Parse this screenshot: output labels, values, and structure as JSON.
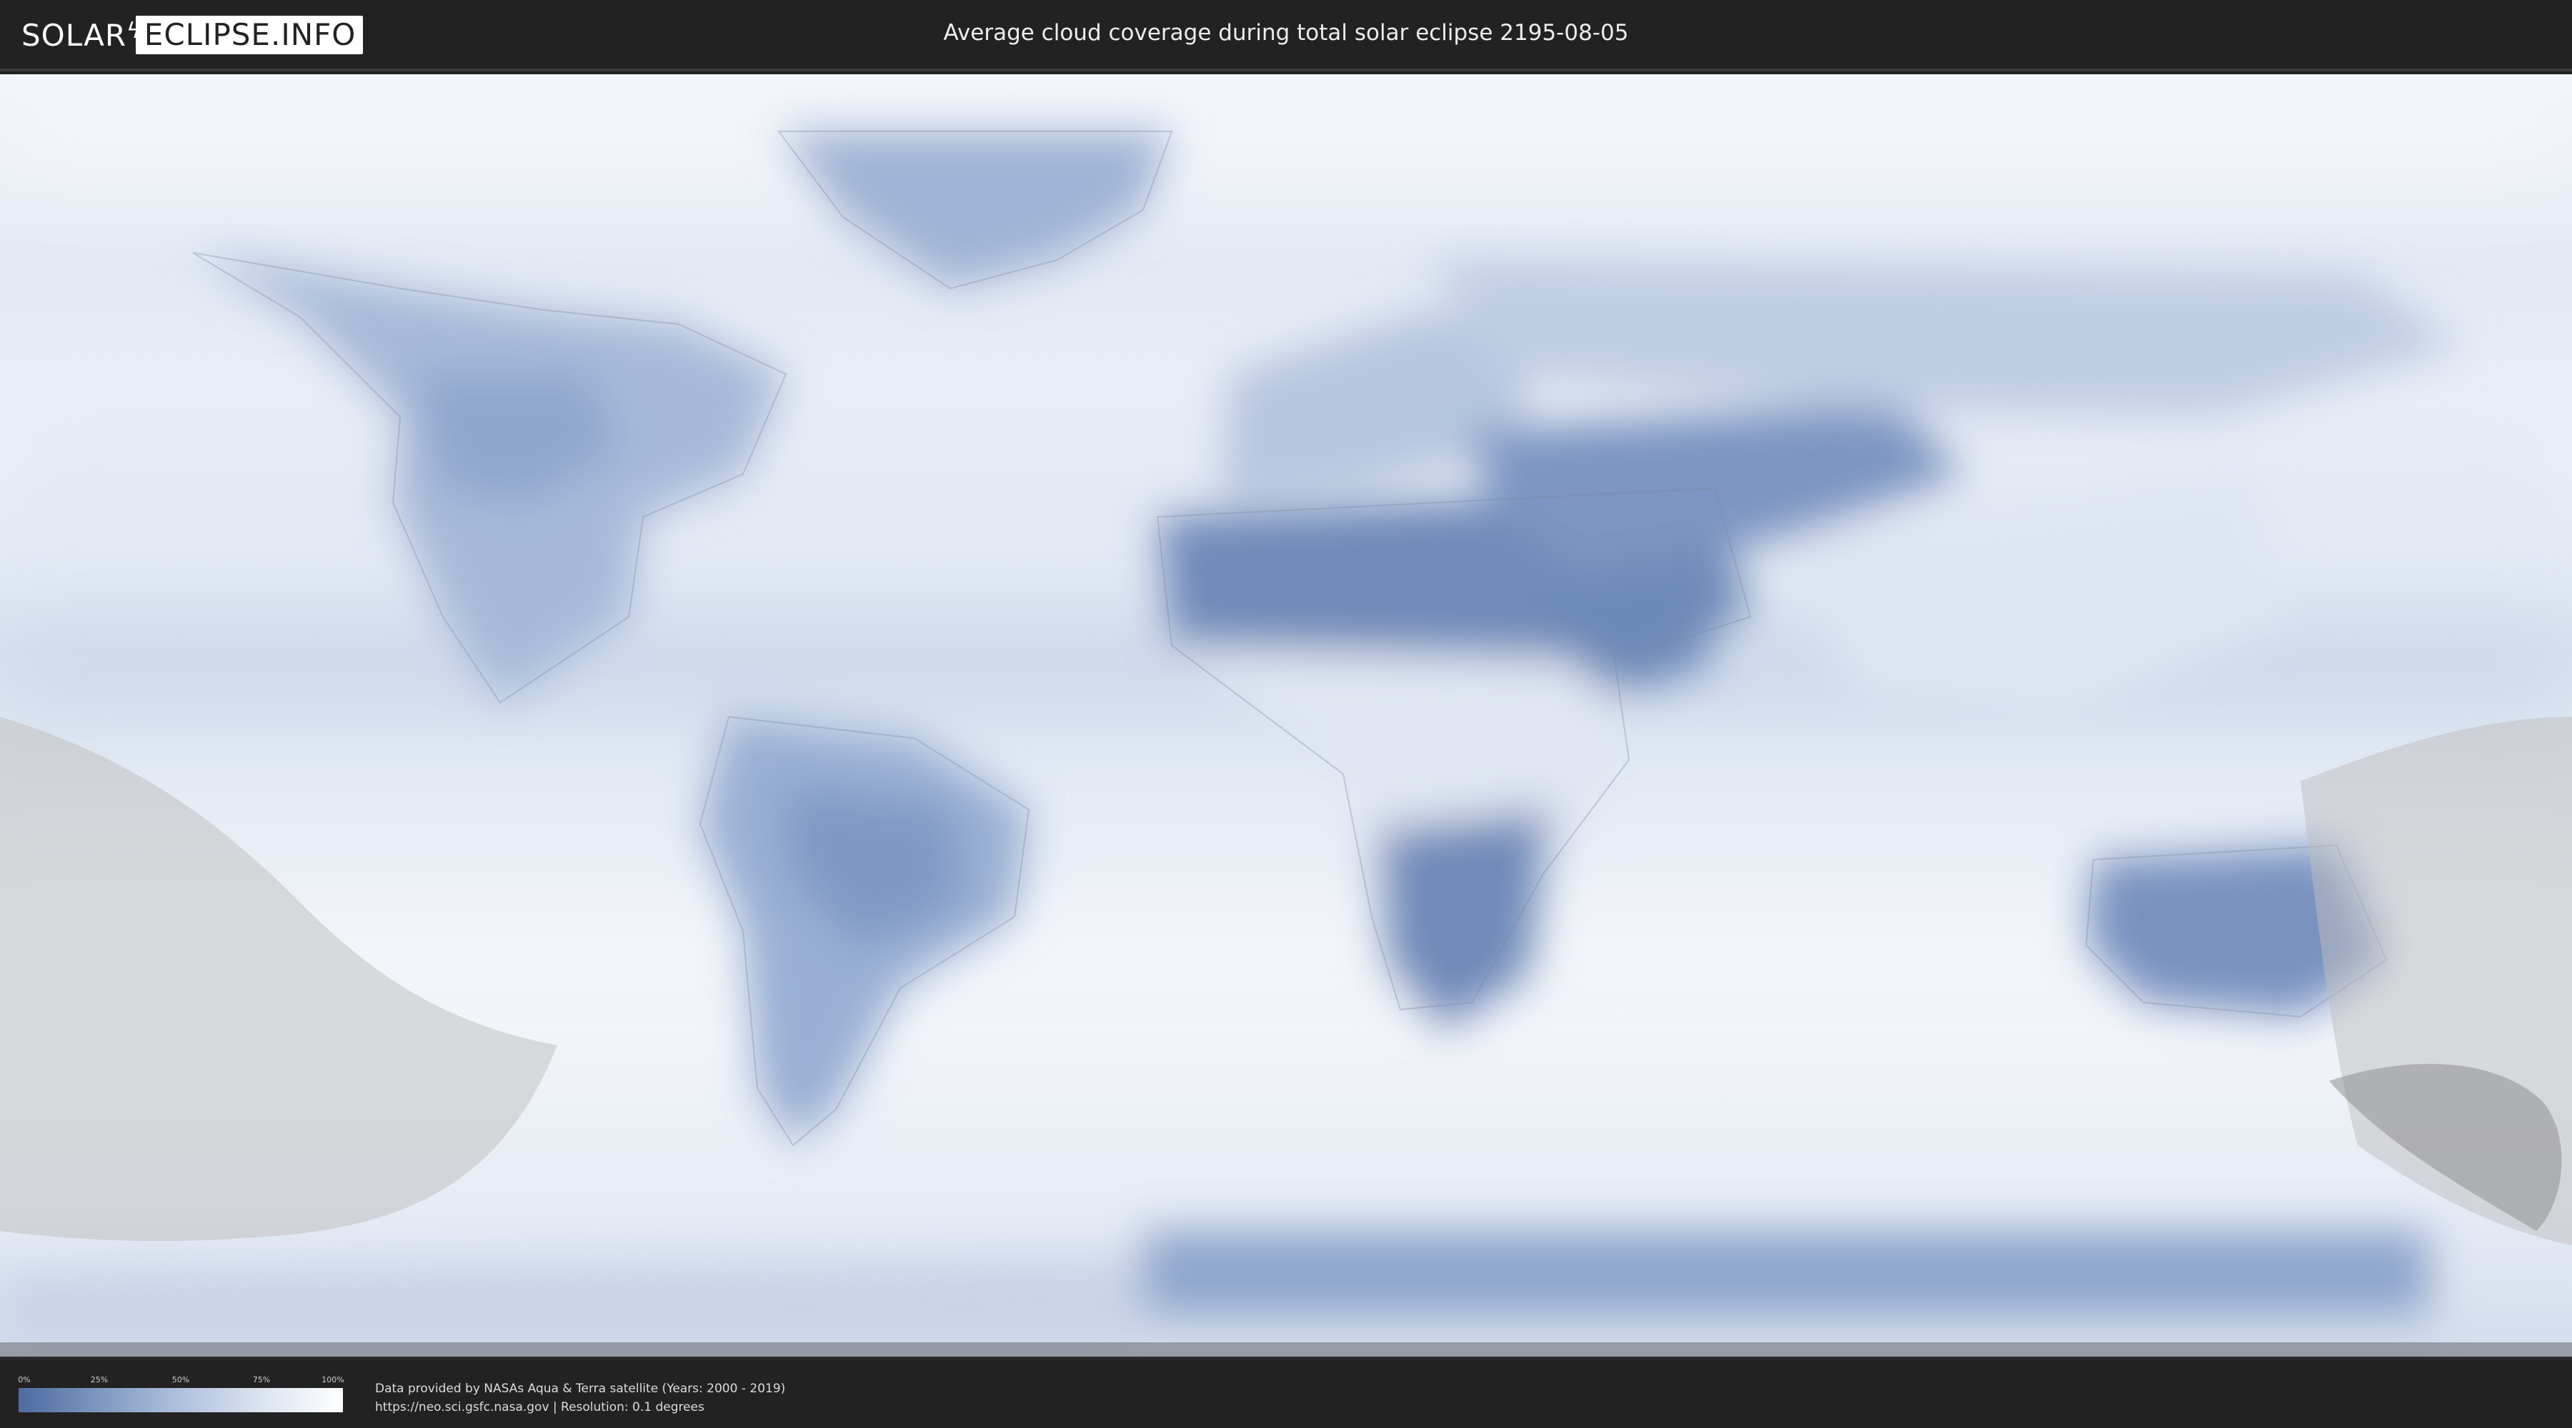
{
  "header": {
    "logo_part1": "SOLAR",
    "logo_part2": "ECLIPSE.INFO",
    "title": "Average cloud coverage during total solar eclipse 2195-08-05"
  },
  "legend": {
    "ticks": [
      "0%",
      "25%",
      "50%",
      "75%",
      "100%"
    ],
    "low_color": "#4e6b9f",
    "high_color": "#ffffff"
  },
  "footer": {
    "credit_line1": "Data provided by NASAs Aqua & Terra satellite (Years: 2000 - 2019)",
    "credit_line2": "https://neo.sci.gsfc.nasa.gov | Resolution: 0.1 degrees"
  },
  "map": {
    "projection": "equirectangular world map",
    "layer": "cloud coverage",
    "eclipse_region_color": "#bdbdbd",
    "umbra_color": "#8f8f8f"
  }
}
